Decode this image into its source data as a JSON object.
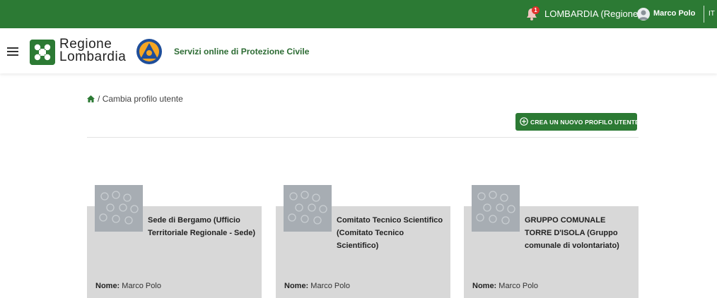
{
  "topbar": {
    "notification_count": "1",
    "region": "LOMBARDIA (Regione)",
    "user_name": "Marco Polo",
    "language": "IT"
  },
  "header": {
    "logo_line1": "Regione",
    "logo_line2": "Lombardia",
    "service_title": "Servizi online di Protezione Civile"
  },
  "breadcrumb": {
    "separator": "/",
    "current": "Cambia profilo utente"
  },
  "create_button": {
    "label": "CREA UN NUOVO PROFILO UTENTE"
  },
  "profiles": [
    {
      "title": "Sede di Bergamo (Ufficio Territoriale Regionale - Sede)",
      "name_label": "Nome:",
      "name_value": "Marco Polo"
    },
    {
      "title": "Comitato Tecnico Scientifico (Comitato Tecnico Scientifico)",
      "name_label": "Nome:",
      "name_value": "Marco Polo"
    },
    {
      "title": "GRUPPO COMUNALE TORRE D'ISOLA (Gruppo comunale di volontariato)",
      "name_label": "Nome:",
      "name_value": "Marco Polo"
    }
  ],
  "colors": {
    "brand_green": "#2c7a34",
    "card_bg": "#d8d8d8",
    "badge_red": "#e0312b"
  },
  "icons": [
    "bell-icon",
    "user-avatar-icon",
    "hamburger-menu-icon",
    "home-icon",
    "plus-circle-icon"
  ]
}
